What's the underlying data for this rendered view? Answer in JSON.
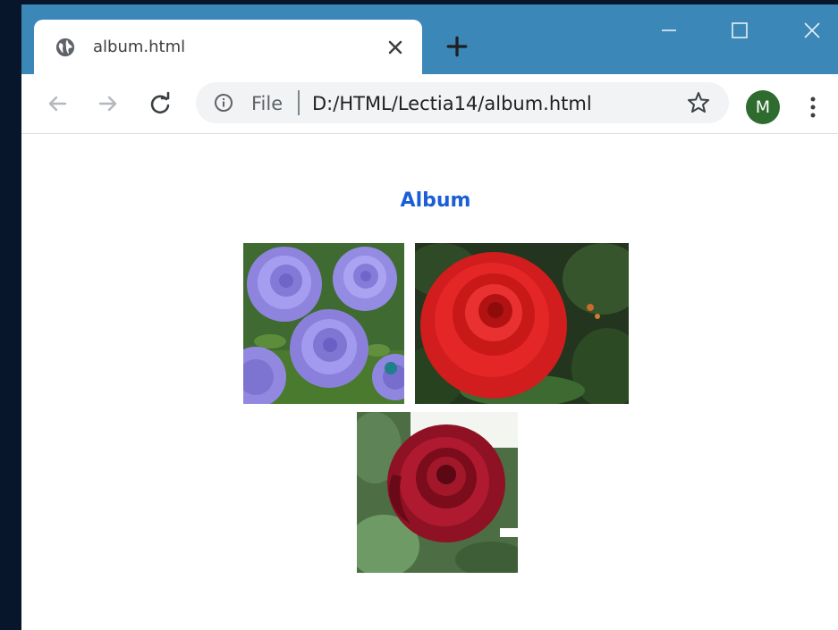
{
  "browser": {
    "tab": {
      "title": "album.html",
      "favicon": "globe-icon",
      "close_icon": "close-icon"
    },
    "new_tab_icon": "plus-icon",
    "window_controls": [
      "minimize-icon",
      "maximize-icon",
      "close-icon"
    ],
    "toolbar": {
      "back_icon": "arrow-left-icon",
      "forward_icon": "arrow-right-icon",
      "reload_icon": "reload-icon",
      "address": {
        "info_icon": "info-icon",
        "scheme_label": "File",
        "url": "D:/HTML/Lectia14/album.html",
        "bookmark_icon": "star-icon"
      },
      "profile_initial": "M",
      "menu_icon": "kebab-menu-icon"
    },
    "colors": {
      "titlebar": "#3a87b8",
      "heading": "#1a5fd6",
      "avatar": "#2e6b2f"
    }
  },
  "page": {
    "heading": "Album",
    "photos": [
      {
        "subject": "purple roses"
      },
      {
        "subject": "red rose"
      },
      {
        "subject": "dark red rose"
      }
    ]
  }
}
